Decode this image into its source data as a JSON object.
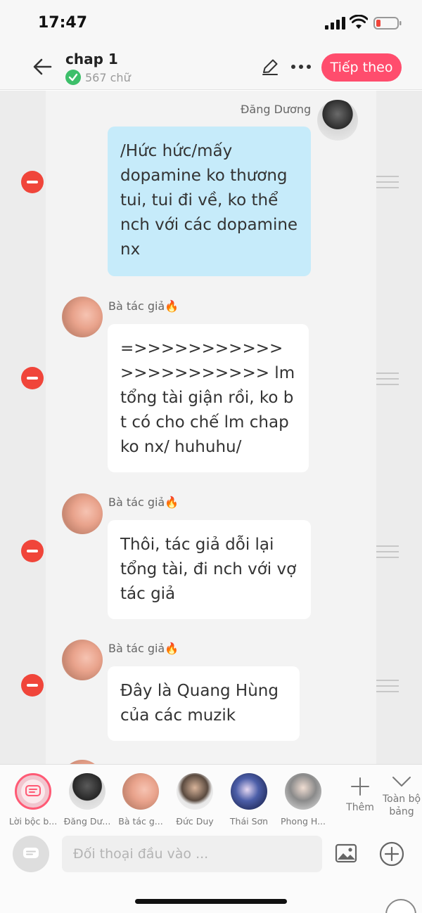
{
  "status_bar": {
    "time": "17:47"
  },
  "header": {
    "title": "chap 1",
    "word_count": "567 chữ",
    "next_label": "Tiếp theo"
  },
  "messages": [
    {
      "speaker": "Đăng Dương",
      "text": "/Hức hức/mấy dopamine ko thương tui, tui đi về, ko thể nch với các dopamine nx",
      "style": "blue",
      "side": "right"
    },
    {
      "speaker": "Bà tác giả🔥",
      "text": "=>>>>>>>>>>>>>>>>>>>>>> lm tổng tài giận rồi, ko bt có cho chế lm chap ko nx/ huhuhu/",
      "style": "white",
      "side": "left"
    },
    {
      "speaker": "Bà tác giả🔥",
      "text": "Thôi, tác giả dỗi lại tổng tài, đi nch với vợ tác giả",
      "style": "white",
      "side": "left"
    },
    {
      "speaker": "Bà tác giả🔥",
      "text": "Đây là Quang Hùng của các muzik",
      "style": "white",
      "side": "left"
    }
  ],
  "characters": [
    {
      "label": "Lời bộc b..."
    },
    {
      "label": "Đăng Dư..."
    },
    {
      "label": "Bà tác g..."
    },
    {
      "label": "Đức Duy"
    },
    {
      "label": "Thái Sơn"
    },
    {
      "label": "Phong H..."
    }
  ],
  "char_actions": {
    "add_label": "Thêm",
    "expand_label": "Toàn bộ bảng"
  },
  "input": {
    "placeholder": "Đối thoại đầu vào ..."
  },
  "colors": {
    "accent": "#ff4d6d",
    "remove": "#f0453a",
    "bubble_blue": "#c6ebfa",
    "verified": "#3dbf6a"
  }
}
